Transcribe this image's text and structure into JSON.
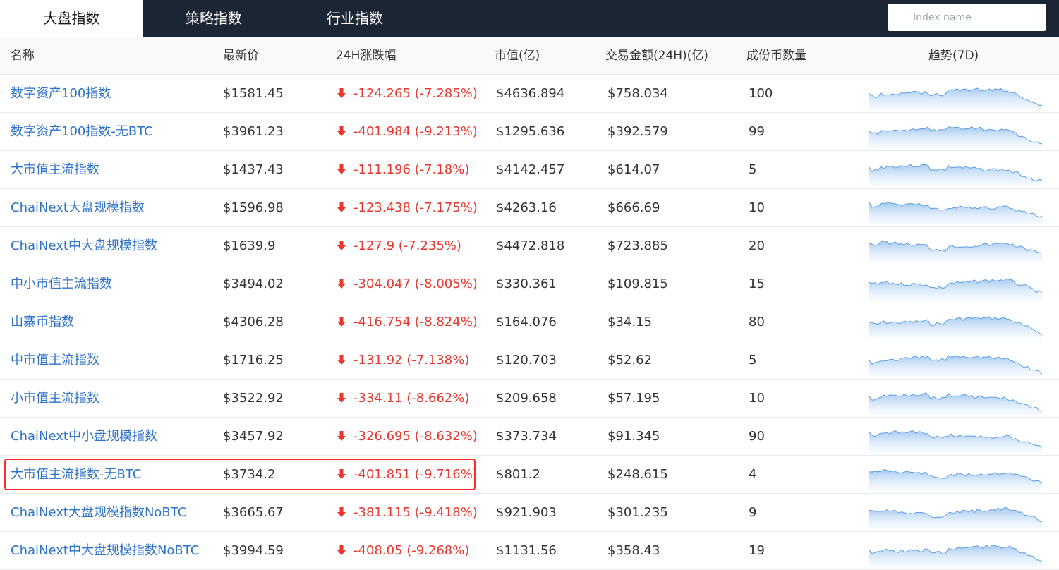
{
  "tabs": [
    {
      "label": "大盘指数"
    },
    {
      "label": "策略指数"
    },
    {
      "label": "行业指数"
    }
  ],
  "search": {
    "placeholder": "Index name"
  },
  "columns": {
    "name": "名称",
    "price": "最新价",
    "change": "24H涨跌幅",
    "market_cap": "市值(亿)",
    "volume": "交易金额(24H)(亿)",
    "constituents": "成份币数量",
    "trend": "趋势(7D)"
  },
  "rows": [
    {
      "name": "数字资产100指数",
      "price": "$1581.45",
      "change": "-124.265 (-7.285%)",
      "market_cap": "$4636.894",
      "volume": "$758.034",
      "constituents": "100"
    },
    {
      "name": "数字资产100指数-无BTC",
      "price": "$3961.23",
      "change": "-401.984 (-9.213%)",
      "market_cap": "$1295.636",
      "volume": "$392.579",
      "constituents": "99"
    },
    {
      "name": "大市值主流指数",
      "price": "$1437.43",
      "change": "-111.196 (-7.18%)",
      "market_cap": "$4142.457",
      "volume": "$614.07",
      "constituents": "5"
    },
    {
      "name": "ChaiNext大盘规模指数",
      "price": "$1596.98",
      "change": "-123.438 (-7.175%)",
      "market_cap": "$4263.16",
      "volume": "$666.69",
      "constituents": "10"
    },
    {
      "name": "ChaiNext中大盘规模指数",
      "price": "$1639.9",
      "change": "-127.9 (-7.235%)",
      "market_cap": "$4472.818",
      "volume": "$723.885",
      "constituents": "20"
    },
    {
      "name": "中小市值主流指数",
      "price": "$3494.02",
      "change": "-304.047 (-8.005%)",
      "market_cap": "$330.361",
      "volume": "$109.815",
      "constituents": "15"
    },
    {
      "name": "山寨币指数",
      "price": "$4306.28",
      "change": "-416.754 (-8.824%)",
      "market_cap": "$164.076",
      "volume": "$34.15",
      "constituents": "80"
    },
    {
      "name": "中市值主流指数",
      "price": "$1716.25",
      "change": "-131.92 (-7.138%)",
      "market_cap": "$120.703",
      "volume": "$52.62",
      "constituents": "5"
    },
    {
      "name": "小市值主流指数",
      "price": "$3522.92",
      "change": "-334.11 (-8.662%)",
      "market_cap": "$209.658",
      "volume": "$57.195",
      "constituents": "10"
    },
    {
      "name": "ChaiNext中小盘规模指数",
      "price": "$3457.92",
      "change": "-326.695 (-8.632%)",
      "market_cap": "$373.734",
      "volume": "$91.345",
      "constituents": "90"
    },
    {
      "name": "大市值主流指数-无BTC",
      "price": "$3734.2",
      "change": "-401.851 (-9.716%)",
      "market_cap": "$801.2",
      "volume": "$248.615",
      "constituents": "4"
    },
    {
      "name": "ChaiNext大盘规模指数NoBTC",
      "price": "$3665.67",
      "change": "-381.115 (-9.418%)",
      "market_cap": "$921.903",
      "volume": "$301.235",
      "constituents": "9"
    },
    {
      "name": "ChaiNext中大盘规模指数NoBTC",
      "price": "$3994.59",
      "change": "-408.05 (-9.268%)",
      "market_cap": "$1131.56",
      "volume": "$358.43",
      "constituents": "19"
    }
  ],
  "icons": {
    "change_direction": "arrow-down-icon",
    "trend": "sparkline-icon"
  },
  "colors": {
    "topbar": "#1b2533",
    "link": "#2f73c9",
    "negative": "#e8372e",
    "sparkline_stroke": "#5b9ee6",
    "sparkline_fill": "#cfe3fa",
    "highlight_border": "#ff2a2a"
  },
  "highlighted_row": 10
}
